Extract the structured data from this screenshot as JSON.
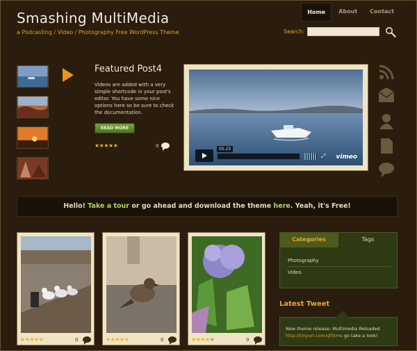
{
  "header": {
    "title": "Smashing MultiMedia",
    "tagline": "a Podcasting / Video / Photography Free WordPress Theme",
    "search_label": "Search:",
    "search_value": ""
  },
  "nav": [
    "Home",
    "About",
    "Contact"
  ],
  "featured": {
    "title": "Featured Post4",
    "body": "Videos are added with a very simple shortcode in your post's editor. You have some nice options here so be sure to check the documentation.",
    "read_more": "READ MORE",
    "stars": "★★★★★",
    "comment_count": "0",
    "rating": 5
  },
  "video": {
    "time": "05:25",
    "brand": "vimeo",
    "progress_percent": 0
  },
  "side_icons": [
    "rss-icon",
    "email-icon",
    "user-icon",
    "document-icon",
    "comment-icon"
  ],
  "welcome": {
    "prefix": "Hello!",
    "link1": "Take a tour",
    "middle": "or go ahead and download the theme",
    "link2": "here",
    "suffix": ". Yeah, it's Free!"
  },
  "gallery": [
    {
      "stars": "★★★★★",
      "comment_count": "0",
      "rating": 5
    },
    {
      "stars": "★★★★★",
      "comment_count": "0",
      "rating": 5
    },
    {
      "stars": "★★★★",
      "stars_empty": "★",
      "comment_count": "0",
      "rating": 4
    }
  ],
  "sidebar": {
    "tabs": [
      "Categories",
      "Tags"
    ],
    "categories": [
      "Photography",
      "Video"
    ]
  },
  "tweet": {
    "title": "Latest Tweet",
    "text": "New theme release: Multimedia Reloaded",
    "link": "http://tinyurl.com/qf5tms",
    "suffix": "go take a look!"
  },
  "colors": {
    "background": "#2a1d0e",
    "accent_orange": "#e0a522",
    "accent_green": "#b3d26a",
    "panel_green": "#2e3a14",
    "cream": "#efe4c4"
  }
}
